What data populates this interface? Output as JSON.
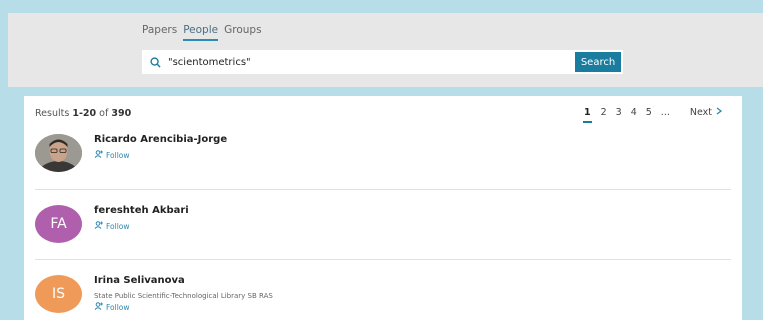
{
  "tabs": [
    {
      "label": "Papers",
      "active": false
    },
    {
      "label": "People",
      "active": true
    },
    {
      "label": "Groups",
      "active": false
    }
  ],
  "search": {
    "query": "\"scientometrics\"",
    "button_label": "Search",
    "icon": "search-icon"
  },
  "results": {
    "prefix": "Results",
    "range": "1-20",
    "of_word": "of",
    "total": "390"
  },
  "pagination": {
    "pages": [
      "1",
      "2",
      "3",
      "4",
      "5"
    ],
    "current": "1",
    "ellipsis": "...",
    "next_label": "Next",
    "next_icon": "chevron-right-icon"
  },
  "people": [
    {
      "name": "Ricardo Arencibia-Jorge",
      "affiliation": "",
      "follow_label": "Follow",
      "avatar_type": "photo",
      "initials": "",
      "avatar_color": "#7a7570"
    },
    {
      "name": "fereshteh Akbari",
      "affiliation": "",
      "follow_label": "Follow",
      "avatar_type": "initials",
      "initials": "FA",
      "avatar_color": "#b05fac"
    },
    {
      "name": "Irina Selivanova",
      "affiliation": "State Public Scientific-Technological Library SB RAS",
      "follow_label": "Follow",
      "avatar_type": "initials",
      "initials": "IS",
      "avatar_color": "#f09a5a"
    }
  ],
  "colors": {
    "background": "#b7dde9",
    "header_band": "#e7e7e7",
    "accent": "#1a7d9f",
    "link": "#2b89b1"
  }
}
